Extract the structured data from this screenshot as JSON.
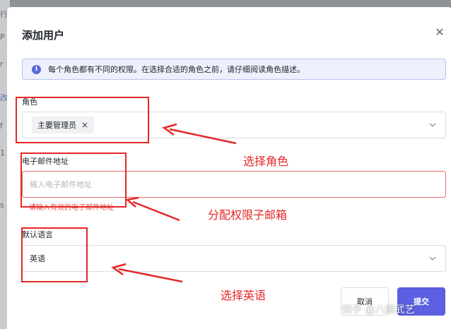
{
  "background": {
    "glyphs": [
      "行",
      "P",
      "r",
      "改",
      "f",
      "1",
      "s"
    ]
  },
  "dialog": {
    "title": "添加用户",
    "close_icon": "close-icon",
    "info_text": "每个角色都有不同的权限。在选择合适的角色之前，请仔细阅读角色描述。",
    "info_icon_glyph": "i"
  },
  "role_field": {
    "label": "角色",
    "selected_tags": [
      "主要管理员"
    ],
    "tag_remove_glyph": "×"
  },
  "email_field": {
    "label": "电子邮件地址",
    "value": "",
    "placeholder": "输入电子邮件地址",
    "error": "请输入有效的电子邮件地址"
  },
  "language_field": {
    "label": "默认语言",
    "value": "英语"
  },
  "buttons": {
    "cancel_label": "取消",
    "submit_label": "提交"
  },
  "annotations": {
    "role_note": "选择角色",
    "email_note": "分配权限子邮箱",
    "language_note": "选择英语",
    "color": "#e52626"
  },
  "watermark": "知乎 @八般武艺",
  "colors": {
    "accent": "#5b5fe0",
    "error": "#e34d4d",
    "info_bg": "#eef1fd"
  }
}
